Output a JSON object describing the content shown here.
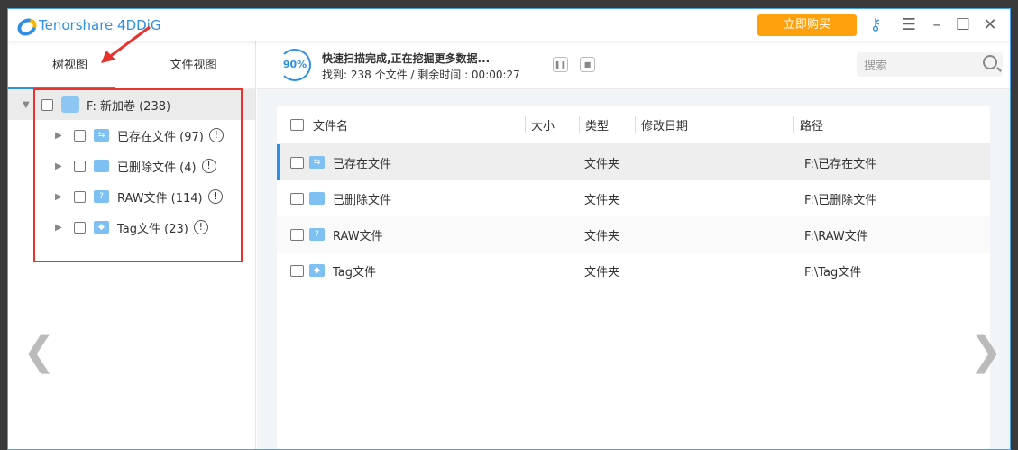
{
  "app": {
    "title": "Tenorshare 4DDiG",
    "buy_label": "立即购买"
  },
  "left_tabs": [
    "树视图",
    "文件视图"
  ],
  "tree": {
    "root": {
      "label": "F: 新加卷 (238)"
    },
    "children": [
      {
        "label": "已存在文件 (97)",
        "icon": "existing-files-folder-icon"
      },
      {
        "label": "已删除文件 (4)",
        "icon": "deleted-files-folder-icon"
      },
      {
        "label": "RAW文件 (114)",
        "icon": "raw-files-folder-icon"
      },
      {
        "label": "Tag文件 (23)",
        "icon": "tag-files-folder-icon"
      }
    ],
    "info_glyph": "!"
  },
  "scan": {
    "percent": "90%",
    "status": "快速扫描完成,正在挖掘更多数据...",
    "found": "找到: 238 个文件 /  剩余时间 : 00:00:27"
  },
  "search": {
    "placeholder": "搜索"
  },
  "table": {
    "columns": [
      "文件名",
      "大小",
      "类型",
      "修改日期",
      "路径"
    ],
    "rows": [
      {
        "name": "已存在文件",
        "size": "",
        "type": "文件夹",
        "date": "",
        "path": "F:\\已存在文件",
        "glyph": "⇆"
      },
      {
        "name": "已删除文件",
        "size": "",
        "type": "文件夹",
        "date": "",
        "path": "F:\\已删除文件",
        "glyph": ""
      },
      {
        "name": "RAW文件",
        "size": "",
        "type": "文件夹",
        "date": "",
        "path": "F:\\RAW文件",
        "glyph": "?"
      },
      {
        "name": "Tag文件",
        "size": "",
        "type": "文件夹",
        "date": "",
        "path": "F:\\Tag文件",
        "glyph": "◆"
      }
    ]
  }
}
